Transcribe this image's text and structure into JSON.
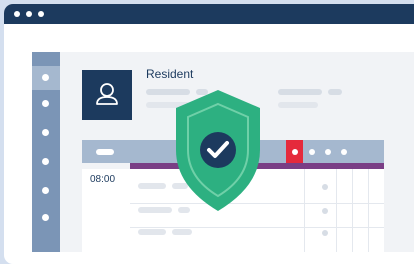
{
  "profile": {
    "name": "Resident"
  },
  "schedule": {
    "time": "08:00"
  },
  "icons": {
    "avatar": "person-icon",
    "badge": "shield-check-icon"
  },
  "colors": {
    "navy": "#1c3a5e",
    "sidebar": "#7b95b6",
    "header": "#a5b8cf",
    "accent_red": "#e52a3c",
    "purple": "#7a3e85",
    "shield_green": "#2db081"
  }
}
